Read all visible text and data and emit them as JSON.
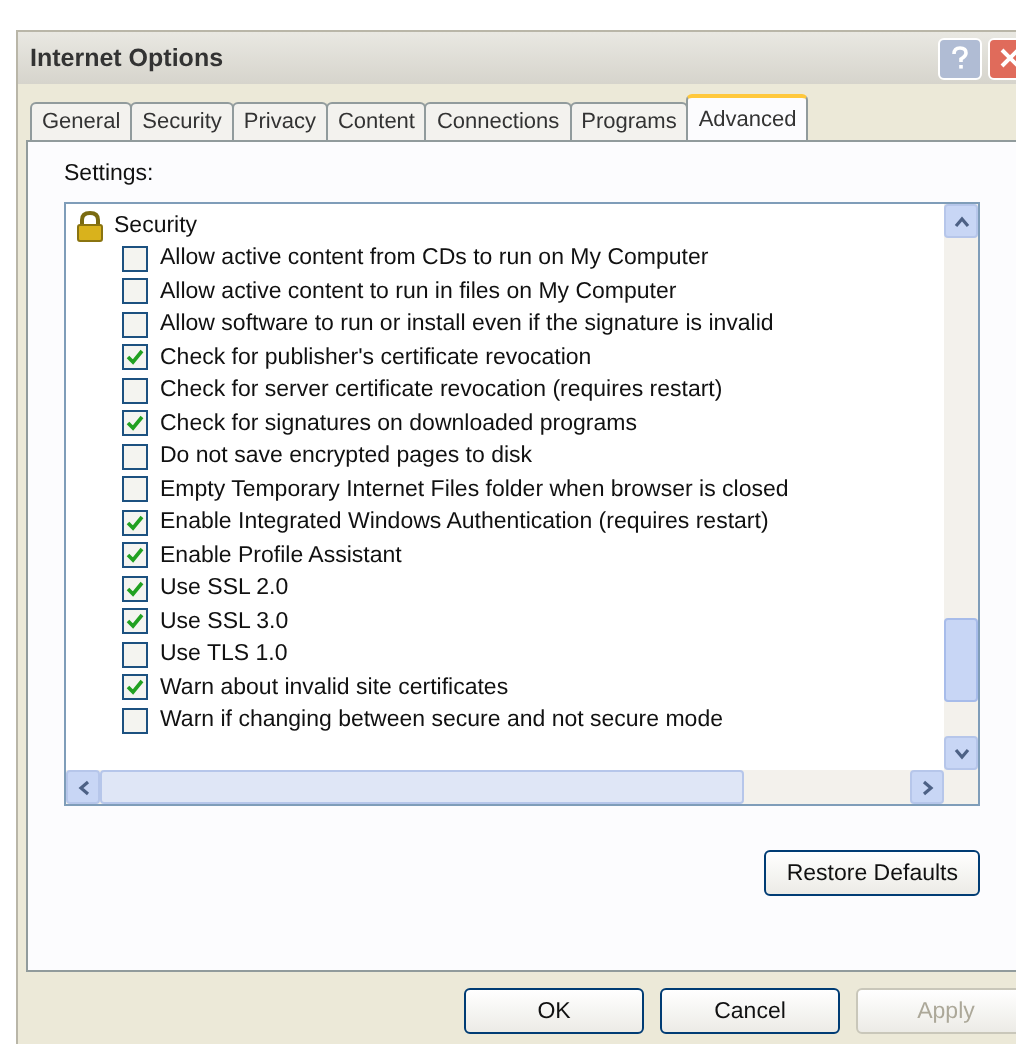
{
  "window": {
    "title": "Internet Options"
  },
  "tabs": [
    {
      "label": "General",
      "selected": false
    },
    {
      "label": "Security",
      "selected": false
    },
    {
      "label": "Privacy",
      "selected": false
    },
    {
      "label": "Content",
      "selected": false
    },
    {
      "label": "Connections",
      "selected": false
    },
    {
      "label": "Programs",
      "selected": false
    },
    {
      "label": "Advanced",
      "selected": true
    }
  ],
  "settings_label": "Settings:",
  "settings": {
    "group": "Security",
    "items": [
      {
        "label": "Allow active content from CDs to run on My Computer",
        "checked": false
      },
      {
        "label": "Allow active content to run in files on My Computer",
        "checked": false
      },
      {
        "label": "Allow software to run or install even if the signature is invalid",
        "checked": false
      },
      {
        "label": "Check for publisher's certificate revocation",
        "checked": true
      },
      {
        "label": "Check for server certificate revocation (requires restart)",
        "checked": false
      },
      {
        "label": "Check for signatures on downloaded programs",
        "checked": true
      },
      {
        "label": "Do not save encrypted pages to disk",
        "checked": false
      },
      {
        "label": "Empty Temporary Internet Files folder when browser is closed",
        "checked": false
      },
      {
        "label": "Enable Integrated Windows Authentication (requires restart)",
        "checked": true
      },
      {
        "label": "Enable Profile Assistant",
        "checked": true
      },
      {
        "label": "Use SSL 2.0",
        "checked": true
      },
      {
        "label": "Use SSL 3.0",
        "checked": true
      },
      {
        "label": "Use TLS 1.0",
        "checked": false
      },
      {
        "label": "Warn about invalid site certificates",
        "checked": true
      },
      {
        "label": "Warn if changing between secure and not secure mode",
        "checked": false
      }
    ]
  },
  "restore_button": "Restore Defaults",
  "buttons": [
    {
      "label": "OK",
      "disabled": false
    },
    {
      "label": "Cancel",
      "disabled": false
    },
    {
      "label": "Apply",
      "disabled": true
    }
  ]
}
